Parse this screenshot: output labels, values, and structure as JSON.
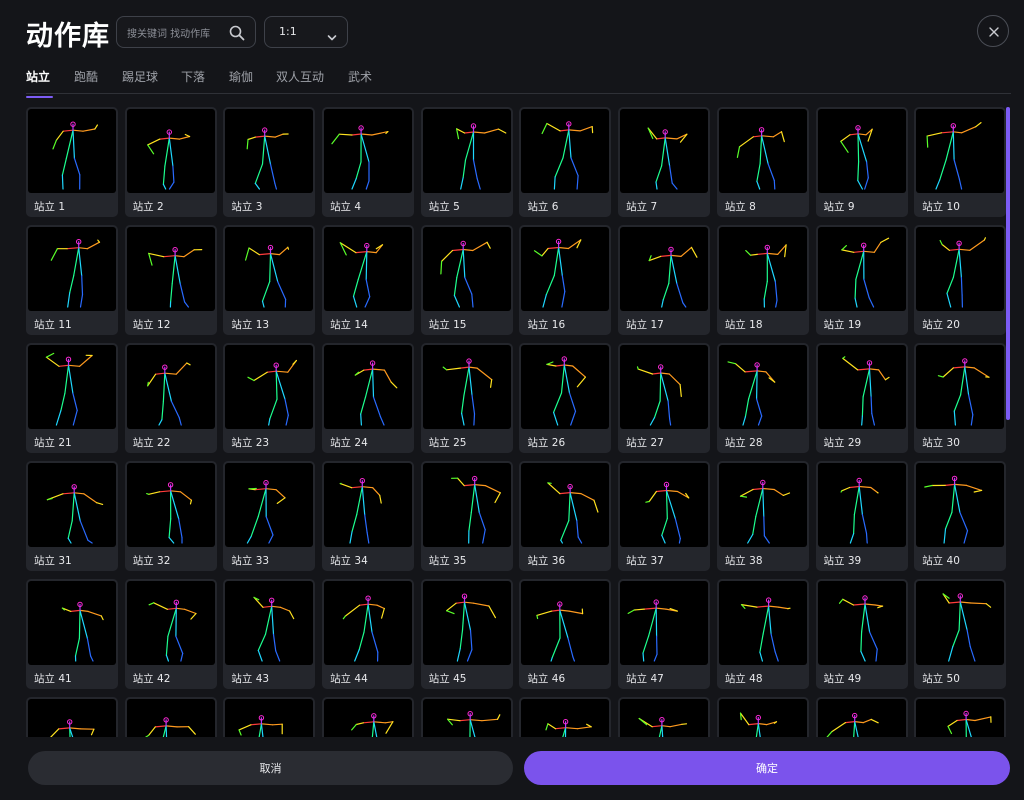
{
  "header": {
    "title": "动作库",
    "search_placeholder": "搜关键词 找动作库",
    "ratio_value": "1:1"
  },
  "tabs": [
    {
      "label": "站立",
      "active": true
    },
    {
      "label": "跑酷",
      "active": false
    },
    {
      "label": "踢足球",
      "active": false
    },
    {
      "label": "下落",
      "active": false
    },
    {
      "label": "瑜伽",
      "active": false
    },
    {
      "label": "双人互动",
      "active": false
    },
    {
      "label": "武术",
      "active": false
    }
  ],
  "poses": [
    {
      "label": "站立 1"
    },
    {
      "label": "站立 2"
    },
    {
      "label": "站立 3"
    },
    {
      "label": "站立 4"
    },
    {
      "label": "站立 5"
    },
    {
      "label": "站立 6"
    },
    {
      "label": "站立 7"
    },
    {
      "label": "站立 8"
    },
    {
      "label": "站立 9"
    },
    {
      "label": "站立 10"
    },
    {
      "label": "站立 11"
    },
    {
      "label": "站立 12"
    },
    {
      "label": "站立 13"
    },
    {
      "label": "站立 14"
    },
    {
      "label": "站立 15"
    },
    {
      "label": "站立 16"
    },
    {
      "label": "站立 17"
    },
    {
      "label": "站立 18"
    },
    {
      "label": "站立 19"
    },
    {
      "label": "站立 20"
    },
    {
      "label": "站立 21"
    },
    {
      "label": "站立 22"
    },
    {
      "label": "站立 23"
    },
    {
      "label": "站立 24"
    },
    {
      "label": "站立 25"
    },
    {
      "label": "站立 26"
    },
    {
      "label": "站立 27"
    },
    {
      "label": "站立 28"
    },
    {
      "label": "站立 29"
    },
    {
      "label": "站立 30"
    },
    {
      "label": "站立 31"
    },
    {
      "label": "站立 32"
    },
    {
      "label": "站立 33"
    },
    {
      "label": "站立 34"
    },
    {
      "label": "站立 35"
    },
    {
      "label": "站立 36"
    },
    {
      "label": "站立 37"
    },
    {
      "label": "站立 38"
    },
    {
      "label": "站立 39"
    },
    {
      "label": "站立 40"
    },
    {
      "label": "站立 41"
    },
    {
      "label": "站立 42"
    },
    {
      "label": "站立 43"
    },
    {
      "label": "站立 44"
    },
    {
      "label": "站立 45"
    },
    {
      "label": "站立 46"
    },
    {
      "label": "站立 47"
    },
    {
      "label": "站立 48"
    },
    {
      "label": "站立 49"
    },
    {
      "label": "站立 50"
    },
    {
      "label": ""
    },
    {
      "label": ""
    },
    {
      "label": ""
    },
    {
      "label": ""
    },
    {
      "label": ""
    },
    {
      "label": ""
    },
    {
      "label": ""
    },
    {
      "label": ""
    },
    {
      "label": ""
    },
    {
      "label": ""
    }
  ],
  "footer": {
    "cancel_label": "取消",
    "confirm_label": "确定"
  },
  "colors": {
    "accent": "#7b53ec",
    "background": "#141519",
    "card": "#24262c"
  },
  "icons": {
    "search": "search-icon",
    "chevron": "chevron-down-icon",
    "close": "close-icon"
  }
}
